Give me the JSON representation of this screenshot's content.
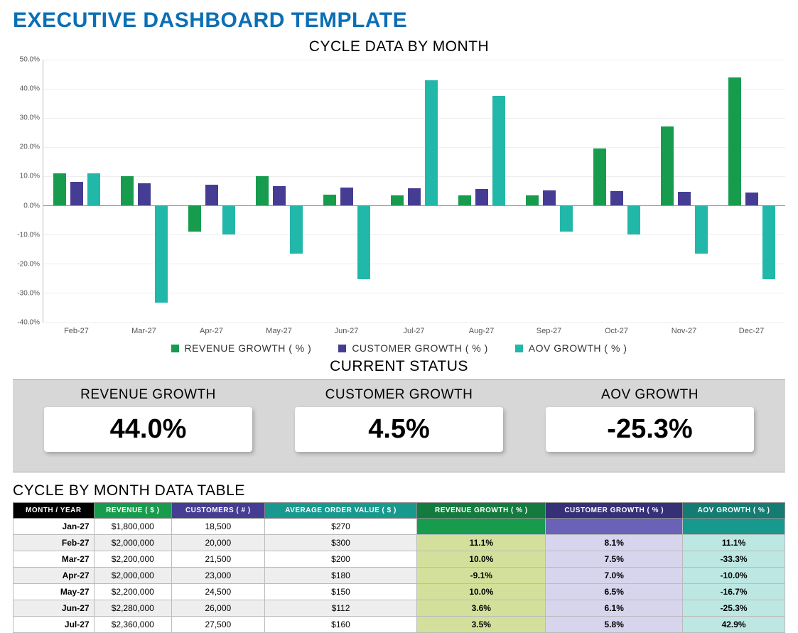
{
  "title": "EXECUTIVE DASHBOARD TEMPLATE",
  "chart": {
    "title": "CYCLE DATA BY MONTH",
    "legend_rev": "REVENUE GROWTH  ( % )",
    "legend_cus": "CUSTOMER GROWTH  ( % )",
    "legend_aov": "AOV GROWTH  ( % )"
  },
  "status": {
    "title": "CURRENT STATUS",
    "cards": [
      {
        "label": "REVENUE GROWTH",
        "value": "44.0%"
      },
      {
        "label": "CUSTOMER GROWTH",
        "value": "4.5%"
      },
      {
        "label": "AOV GROWTH",
        "value": "-25.3%"
      }
    ]
  },
  "table": {
    "title": "CYCLE BY MONTH DATA TABLE",
    "headers": {
      "month": "MONTH / YEAR",
      "rev": "REVENUE  ( $ )",
      "cus": "CUSTOMERS  ( # )",
      "aov": "AVERAGE ORDER VALUE  ( $ )",
      "revg": "REVENUE GROWTH  ( % )",
      "cusg": "CUSTOMER GROWTH  ( % )",
      "aovg": "AOV GROWTH  ( % )"
    },
    "rows": [
      {
        "month": "Jan-27",
        "rev": "$1,800,000",
        "cus": "18,500",
        "aov": "$270",
        "revg": "",
        "cusg": "",
        "aovg": ""
      },
      {
        "month": "Feb-27",
        "rev": "$2,000,000",
        "cus": "20,000",
        "aov": "$300",
        "revg": "11.1%",
        "cusg": "8.1%",
        "aovg": "11.1%"
      },
      {
        "month": "Mar-27",
        "rev": "$2,200,000",
        "cus": "21,500",
        "aov": "$200",
        "revg": "10.0%",
        "cusg": "7.5%",
        "aovg": "-33.3%"
      },
      {
        "month": "Apr-27",
        "rev": "$2,000,000",
        "cus": "23,000",
        "aov": "$180",
        "revg": "-9.1%",
        "cusg": "7.0%",
        "aovg": "-10.0%"
      },
      {
        "month": "May-27",
        "rev": "$2,200,000",
        "cus": "24,500",
        "aov": "$150",
        "revg": "10.0%",
        "cusg": "6.5%",
        "aovg": "-16.7%"
      },
      {
        "month": "Jun-27",
        "rev": "$2,280,000",
        "cus": "26,000",
        "aov": "$112",
        "revg": "3.6%",
        "cusg": "6.1%",
        "aovg": "-25.3%"
      },
      {
        "month": "Jul-27",
        "rev": "$2,360,000",
        "cus": "27,500",
        "aov": "$160",
        "revg": "3.5%",
        "cusg": "5.8%",
        "aovg": "42.9%"
      }
    ]
  },
  "chart_data": {
    "type": "bar",
    "title": "CYCLE DATA BY MONTH",
    "xlabel": "",
    "ylabel": "",
    "ylim": [
      -40,
      50
    ],
    "y_ticks": [
      "50.0%",
      "40.0%",
      "30.0%",
      "20.0%",
      "10.0%",
      "0.0%",
      "-10.0%",
      "-20.0%",
      "-30.0%",
      "-40.0%"
    ],
    "categories": [
      "Feb-27",
      "Mar-27",
      "Apr-27",
      "May-27",
      "Jun-27",
      "Jul-27",
      "Aug-27",
      "Sep-27",
      "Oct-27",
      "Nov-27",
      "Dec-27"
    ],
    "colors": {
      "REVENUE GROWTH  ( % )": "#179c4e",
      "CUSTOMER GROWTH  ( % )": "#453d93",
      "AOV GROWTH  ( % )": "#22b8a9"
    },
    "series": [
      {
        "name": "REVENUE GROWTH  ( % )",
        "values": [
          11.1,
          10.0,
          -9.1,
          10.0,
          3.6,
          3.5,
          3.4,
          3.3,
          19.4,
          27.0,
          44.0
        ]
      },
      {
        "name": "CUSTOMER GROWTH  ( % )",
        "values": [
          8.1,
          7.5,
          7.0,
          6.5,
          6.1,
          5.8,
          5.5,
          5.2,
          4.9,
          4.7,
          4.5
        ]
      },
      {
        "name": "AOV GROWTH  ( % )",
        "values": [
          11.1,
          -33.3,
          -10.0,
          -16.7,
          -25.3,
          42.9,
          37.5,
          -9.1,
          -10.0,
          -16.7,
          -25.3
        ]
      }
    ]
  }
}
